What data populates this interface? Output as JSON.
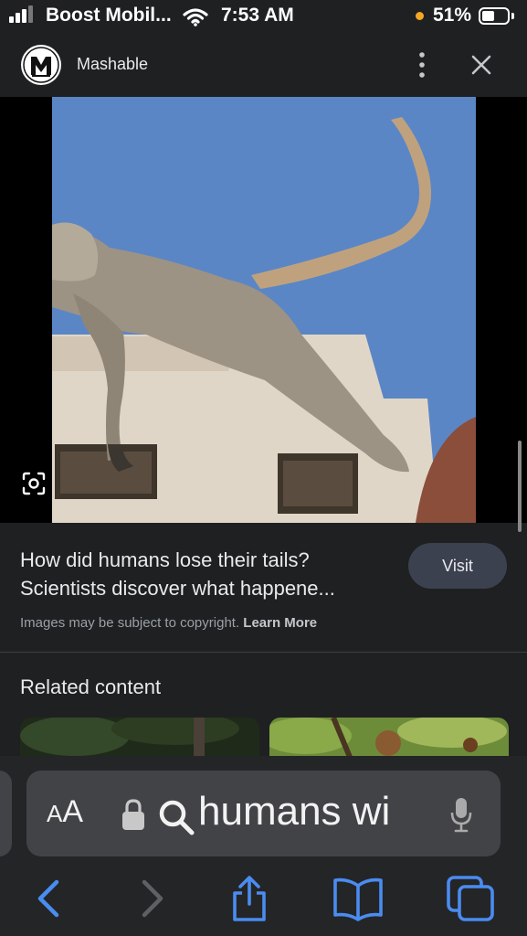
{
  "status_bar": {
    "carrier": "Boost Mobil...",
    "time": "7:53 AM",
    "battery_percent": "51%",
    "battery_level": 0.51,
    "indicator_color": "#f5a623"
  },
  "header": {
    "logo_letter": "M",
    "source": "Mashable"
  },
  "result": {
    "title_line1": "How did humans lose their tails?",
    "title_line2": "Scientists discover what happene...",
    "visit_label": "Visit",
    "copyright_text": "Images may be subject to copyright.",
    "learn_more": "Learn More"
  },
  "related": {
    "heading": "Related content"
  },
  "safari": {
    "text_size_label_big": "A",
    "text_size_label_small": "A",
    "query": "humans wi",
    "accent_color": "#4a8cf0"
  }
}
